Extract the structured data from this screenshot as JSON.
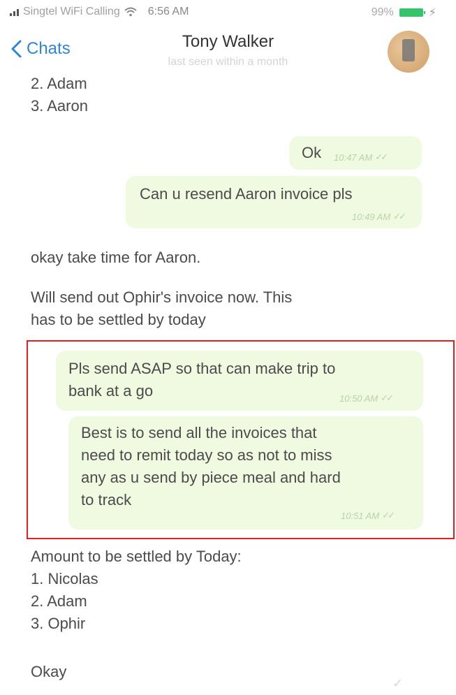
{
  "status_bar": {
    "carrier": "Singtel WiFi Calling",
    "time": "6:56 AM",
    "battery": "99%"
  },
  "header": {
    "back_label": "Chats",
    "contact_name": "Tony Walker",
    "last_seen": "last seen within a month"
  },
  "messages": {
    "m1": "2. Adam\n3. Aaron",
    "m2_text": "Ok",
    "m2_time": "10:47 AM",
    "m3_text": "Can u resend Aaron invoice pls",
    "m3_time": "10:49 AM",
    "m4": "okay take time for Aaron.",
    "m5": "Will send out Ophir's invoice now. This\nhas to be settled by today",
    "m6_text": "Pls send ASAP so that can make trip to\nbank at a go",
    "m6_time": "10:50 AM",
    "m7_text": "Best is to send all the invoices that\nneed to remit today so as not to miss\nany as u send by piece meal and hard\nto track",
    "m7_time": "10:51 AM",
    "m8": "Amount to be settled by Today:\n1. Nicolas\n2. Adam\n3. Ophir",
    "m9": "Okay"
  },
  "icons": {
    "back": "chevron-left-icon",
    "wifi": "wifi-icon",
    "signal": "signal-icon",
    "battery": "battery-icon",
    "read_receipt": "double-check-icon"
  },
  "colors": {
    "accent": "#2f86d6",
    "outgoing_bubble": "#f0fae0",
    "highlight_border": "#e21f1f",
    "battery": "#36c46a"
  }
}
